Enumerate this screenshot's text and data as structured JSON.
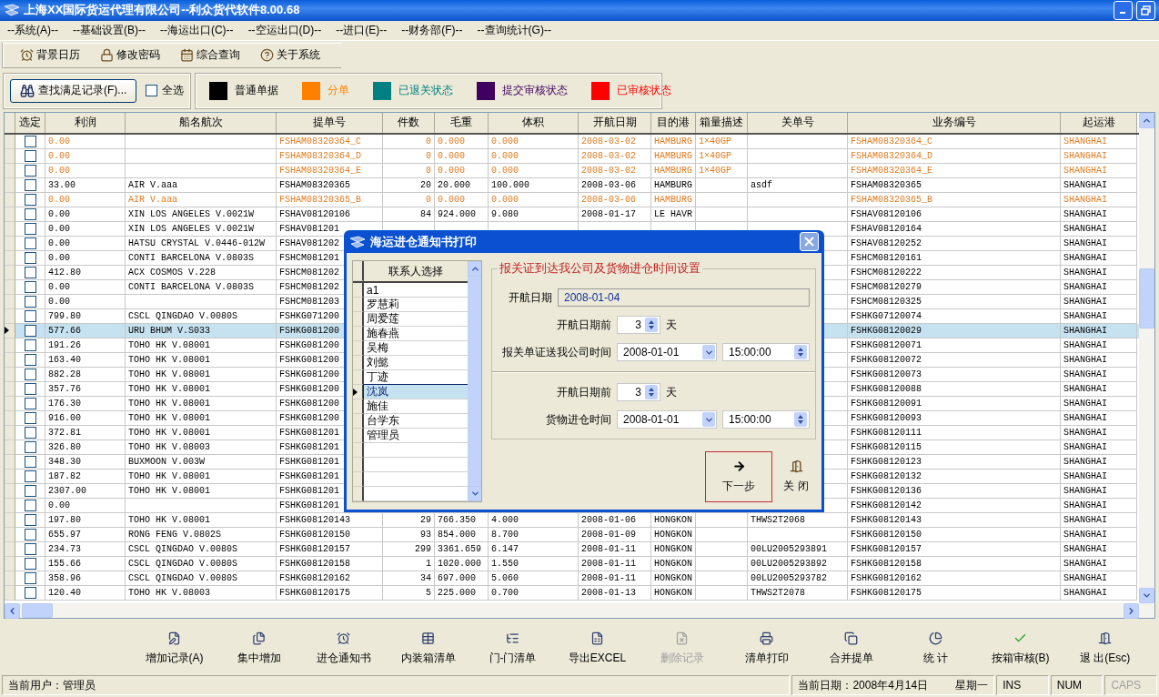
{
  "window": {
    "title": "上海XX国际货运代理有限公司--利众货代软件8.00.68"
  },
  "menu": [
    "--系统(A)--",
    "--基础设置(B)--",
    "--海运出口(C)--",
    "--空运出口(D)--",
    "--进口(E)--",
    "--财务部(F)--",
    "--查询统计(G)--"
  ],
  "toolbar": [
    "背景日历",
    "修改密码",
    "综合查询",
    "关于系统"
  ],
  "filter": {
    "find_button": "查找满足记录(F)...",
    "select_all": {
      "label": "全选",
      "checked": false
    }
  },
  "legend": [
    {
      "label": "普通单据",
      "color": "#000000"
    },
    {
      "label": "分单",
      "color": "#ff8000"
    },
    {
      "label": "已退关状态",
      "color": "#008080"
    },
    {
      "label": "提交审核状态",
      "color": "#400060"
    },
    {
      "label": "已审核状态",
      "color": "#ff0000"
    }
  ],
  "table": {
    "select_header": "选定",
    "columns": [
      "利润",
      "船名航次",
      "提单号",
      "件数",
      "毛重",
      "体积",
      "开航日期",
      "目的港",
      "箱量描述",
      "关单号",
      "业务编号",
      "起运港"
    ],
    "rows": [
      {
        "kind": "split",
        "selected": false,
        "checked": false,
        "cells": [
          "0.00",
          null,
          "FSHAM08320364_C",
          "0",
          "0.000",
          "0.000",
          "2008-03-02",
          "HAMBURG",
          "1×40GP",
          null,
          "FSHAM08320364_C",
          "SHANGHAI"
        ]
      },
      {
        "kind": "split",
        "selected": false,
        "checked": false,
        "cells": [
          "0.00",
          null,
          "FSHAM08320364_D",
          "0",
          "0.000",
          "0.000",
          "2008-03-02",
          "HAMBURG",
          "1×40GP",
          null,
          "FSHAM08320364_D",
          "SHANGHAI"
        ]
      },
      {
        "kind": "split",
        "selected": false,
        "checked": false,
        "cells": [
          "0.00",
          null,
          "FSHAM08320364_E",
          "0",
          "0.000",
          "0.000",
          "2008-03-02",
          "HAMBURG",
          "1×40GP",
          null,
          "FSHAM08320364_E",
          "SHANGHAI"
        ]
      },
      {
        "kind": "normal",
        "selected": false,
        "checked": false,
        "cells": [
          "33.00",
          "AIR V.aaa",
          "FSHAM08320365",
          "20",
          "20.000",
          "100.000",
          "2008-03-06",
          "HAMBURG",
          null,
          "asdf",
          "FSHAM08320365",
          "SHANGHAI"
        ]
      },
      {
        "kind": "split",
        "selected": false,
        "checked": false,
        "cells": [
          "0.00",
          "AIR V.aaa",
          "FSHAM08320365_B",
          "0",
          "0.000",
          "0.000",
          "2008-03-06",
          "HAMBURG",
          null,
          null,
          "FSHAM08320365_B",
          "SHANGHAI"
        ]
      },
      {
        "kind": "normal",
        "selected": false,
        "checked": false,
        "cells": [
          "0.00",
          "XIN LOS ANGELES V.0021W",
          "FSHAV08120106",
          "84",
          "924.000",
          "9.080",
          "2008-01-17",
          "LE HAVR",
          null,
          null,
          "FSHAV08120106",
          "SHANGHAI"
        ]
      },
      {
        "kind": "normal",
        "selected": false,
        "checked": false,
        "cells": [
          "0.00",
          "XIN LOS ANGELES V.0021W",
          "FSHAV081201",
          null,
          null,
          null,
          null,
          null,
          null,
          null,
          "FSHAV08120164",
          "SHANGHAI"
        ]
      },
      {
        "kind": "normal",
        "selected": false,
        "checked": false,
        "cells": [
          "0.00",
          "HATSU CRYSTAL V.0446-012W",
          "FSHAV081202",
          null,
          null,
          null,
          null,
          null,
          null,
          null,
          "FSHAV08120252",
          "SHANGHAI"
        ]
      },
      {
        "kind": "normal",
        "selected": false,
        "checked": false,
        "cells": [
          "0.00",
          "CONTI BARCELONA V.0803S",
          "FSHCM081201",
          null,
          null,
          null,
          null,
          null,
          null,
          null,
          "FSHCM08120161",
          "SHANGHAI"
        ]
      },
      {
        "kind": "normal",
        "selected": false,
        "checked": false,
        "cells": [
          "412.80",
          "ACX COSMOS V.228",
          "FSHCM081202",
          null,
          null,
          null,
          null,
          null,
          null,
          null,
          "FSHCM08120222",
          "SHANGHAI"
        ]
      },
      {
        "kind": "normal",
        "selected": false,
        "checked": false,
        "cells": [
          "0.00",
          "CONTI BARCELONA V.0803S",
          "FSHCM081202",
          null,
          null,
          null,
          null,
          null,
          null,
          null,
          "FSHCM08120279",
          "SHANGHAI"
        ]
      },
      {
        "kind": "normal",
        "selected": false,
        "checked": false,
        "cells": [
          "0.00",
          null,
          "FSHCM081203",
          null,
          null,
          null,
          null,
          null,
          null,
          null,
          "FSHCM08120325",
          "SHANGHAI"
        ]
      },
      {
        "kind": "normal",
        "selected": false,
        "checked": false,
        "cells": [
          "799.80",
          "CSCL QINGDAO V.0080S",
          "FSHKG071200",
          null,
          null,
          null,
          null,
          null,
          null,
          null,
          "FSHKG07120074",
          "SHANGHAI"
        ]
      },
      {
        "kind": "normal",
        "selected": true,
        "checked": false,
        "cells": [
          "577.66",
          "URU BHUM V.S033",
          "FSHKG081200",
          null,
          null,
          null,
          null,
          null,
          null,
          null,
          "FSHKG08120029",
          "SHANGHAI"
        ]
      },
      {
        "kind": "normal",
        "selected": false,
        "checked": false,
        "cells": [
          "191.26",
          "TOHO HK V.08001",
          "FSHKG081200",
          null,
          null,
          null,
          null,
          null,
          null,
          null,
          "FSHKG08120071",
          "SHANGHAI"
        ]
      },
      {
        "kind": "normal",
        "selected": false,
        "checked": false,
        "cells": [
          "163.40",
          "TOHO HK V.08001",
          "FSHKG081200",
          null,
          null,
          null,
          null,
          null,
          null,
          null,
          "FSHKG08120072",
          "SHANGHAI"
        ]
      },
      {
        "kind": "normal",
        "selected": false,
        "checked": false,
        "cells": [
          "882.28",
          "TOHO HK V.08001",
          "FSHKG081200",
          null,
          null,
          null,
          null,
          null,
          null,
          null,
          "FSHKG08120073",
          "SHANGHAI"
        ]
      },
      {
        "kind": "normal",
        "selected": false,
        "checked": false,
        "cells": [
          "357.76",
          "TOHO HK V.08001",
          "FSHKG081200",
          null,
          null,
          null,
          null,
          null,
          null,
          null,
          "FSHKG08120088",
          "SHANGHAI"
        ]
      },
      {
        "kind": "normal",
        "selected": false,
        "checked": false,
        "cells": [
          "176.30",
          "TOHO HK V.08001",
          "FSHKG081200",
          null,
          null,
          null,
          null,
          null,
          null,
          null,
          "FSHKG08120091",
          "SHANGHAI"
        ]
      },
      {
        "kind": "normal",
        "selected": false,
        "checked": false,
        "cells": [
          "916.00",
          "TOHO HK V.08001",
          "FSHKG081200",
          null,
          null,
          null,
          null,
          null,
          null,
          null,
          "FSHKG08120093",
          "SHANGHAI"
        ]
      },
      {
        "kind": "normal",
        "selected": false,
        "checked": false,
        "cells": [
          "372.81",
          "TOHO HK V.08001",
          "FSHKG081201",
          null,
          null,
          null,
          null,
          null,
          null,
          null,
          "FSHKG08120111",
          "SHANGHAI"
        ]
      },
      {
        "kind": "normal",
        "selected": false,
        "checked": false,
        "cells": [
          "326.80",
          "TOHO HK V.08003",
          "FSHKG081201",
          null,
          null,
          null,
          null,
          null,
          null,
          null,
          "FSHKG08120115",
          "SHANGHAI"
        ]
      },
      {
        "kind": "normal",
        "selected": false,
        "checked": false,
        "cells": [
          "348.30",
          "BUXMOON V.003W",
          "FSHKG081201",
          null,
          null,
          null,
          null,
          null,
          null,
          null,
          "FSHKG08120123",
          "SHANGHAI"
        ]
      },
      {
        "kind": "normal",
        "selected": false,
        "checked": false,
        "cells": [
          "187.82",
          "TOHO HK V.08001",
          "FSHKG081201",
          null,
          null,
          null,
          null,
          null,
          null,
          null,
          "FSHKG08120132",
          "SHANGHAI"
        ]
      },
      {
        "kind": "normal",
        "selected": false,
        "checked": false,
        "cells": [
          "2307.00",
          "TOHO HK V.08001",
          "FSHKG081201",
          null,
          null,
          null,
          null,
          null,
          null,
          null,
          "FSHKG08120136",
          "SHANGHAI"
        ]
      },
      {
        "kind": "normal",
        "selected": false,
        "checked": false,
        "cells": [
          "0.00",
          null,
          "FSHKG081201",
          null,
          null,
          null,
          null,
          null,
          null,
          null,
          "FSHKG08120142",
          "SHANGHAI"
        ]
      },
      {
        "kind": "normal",
        "selected": false,
        "checked": false,
        "cells": [
          "197.80",
          "TOHO HK V.08001",
          "FSHKG08120143",
          "29",
          "766.350",
          "4.000",
          "2008-01-06",
          "HONGKON",
          null,
          "THWS2T2068",
          "FSHKG08120143",
          "SHANGHAI"
        ]
      },
      {
        "kind": "normal",
        "selected": false,
        "checked": false,
        "cells": [
          "655.97",
          "RONG FENG V.0802S",
          "FSHKG08120150",
          "93",
          "854.000",
          "8.700",
          "2008-01-09",
          "HONGKON",
          null,
          null,
          "FSHKG08120150",
          "SHANGHAI"
        ]
      },
      {
        "kind": "normal",
        "selected": false,
        "checked": false,
        "cells": [
          "234.73",
          "CSCL QINGDAO V.0080S",
          "FSHKG08120157",
          "299",
          "3361.659",
          "6.147",
          "2008-01-11",
          "HONGKON",
          null,
          "00LU2005293891",
          "FSHKG08120157",
          "SHANGHAI"
        ]
      },
      {
        "kind": "normal",
        "selected": false,
        "checked": false,
        "cells": [
          "155.66",
          "CSCL QINGDAO V.0080S",
          "FSHKG08120158",
          "1",
          "1020.000",
          "1.550",
          "2008-01-11",
          "HONGKON",
          null,
          "00LU2005293892",
          "FSHKG08120158",
          "SHANGHAI"
        ]
      },
      {
        "kind": "normal",
        "selected": false,
        "checked": false,
        "cells": [
          "358.96",
          "CSCL QINGDAO V.0080S",
          "FSHKG08120162",
          "34",
          "697.000",
          "5.060",
          "2008-01-11",
          "HONGKON",
          null,
          "00LU2005293782",
          "FSHKG08120162",
          "SHANGHAI"
        ]
      },
      {
        "kind": "normal",
        "selected": false,
        "checked": false,
        "cells": [
          "120.40",
          "TOHO HK V.08003",
          "FSHKG08120175",
          "5",
          "225.000",
          "0.700",
          "2008-01-13",
          "HONGKON",
          null,
          "THWS2T2078",
          "FSHKG08120175",
          "SHANGHAI"
        ]
      }
    ]
  },
  "dialog": {
    "title": "海运进仓通知书打印",
    "contacts": {
      "header": "联系人选择",
      "items": [
        {
          "name": "a1",
          "selected": false
        },
        {
          "name": "罗慧莉",
          "selected": false
        },
        {
          "name": "周爱莲",
          "selected": false
        },
        {
          "name": "施春燕",
          "selected": false
        },
        {
          "name": "吴梅",
          "selected": false
        },
        {
          "name": "刘懿",
          "selected": false
        },
        {
          "name": "丁迹",
          "selected": false
        },
        {
          "name": "沈岚",
          "selected": true
        },
        {
          "name": "施佳",
          "selected": false
        },
        {
          "name": "台学东",
          "selected": false
        },
        {
          "name": "管理员",
          "selected": false
        }
      ]
    },
    "group_title": "报关证到达我公司及货物进仓时间设置",
    "sail_date": {
      "label": "开航日期",
      "value": "2008-01-04"
    },
    "sections": [
      {
        "days_label": "开航日期前",
        "days": "3",
        "unit": "天",
        "time_label": "报关单证送我公司时间",
        "date": "2008-01-01",
        "time": "15:00:00"
      },
      {
        "days_label": "开航日期前",
        "days": "3",
        "unit": "天",
        "time_label": "货物进仓时间",
        "date": "2008-01-01",
        "time": "15:00:00"
      }
    ],
    "buttons": [
      {
        "label": "下一步",
        "focused": true
      },
      {
        "label": "关 闭",
        "focused": false
      }
    ]
  },
  "bottom_toolbar": [
    {
      "label": "增加记录(A)",
      "disabled": false
    },
    {
      "label": "集中增加",
      "disabled": false
    },
    {
      "label": "进仓通知书",
      "disabled": false
    },
    {
      "label": "内装箱清单",
      "disabled": false
    },
    {
      "label": "门-门清单",
      "disabled": false
    },
    {
      "label": "导出EXCEL",
      "disabled": false
    },
    {
      "label": "删除记录",
      "disabled": true
    },
    {
      "label": "清单打印",
      "disabled": false
    },
    {
      "label": "合并提单",
      "disabled": false
    },
    {
      "label": "统 计",
      "disabled": false
    },
    {
      "label": "按箱审核(B)",
      "disabled": false
    },
    {
      "label": "退 出(Esc)",
      "disabled": false
    }
  ],
  "status_bar": {
    "user": "当前用户：管理员",
    "date": "当前日期：2008年4月14日",
    "weekday": "星期一",
    "keys": [
      {
        "label": "INS",
        "on": true
      },
      {
        "label": "NUM",
        "on": true
      },
      {
        "label": "CAPS",
        "on": false
      }
    ]
  }
}
